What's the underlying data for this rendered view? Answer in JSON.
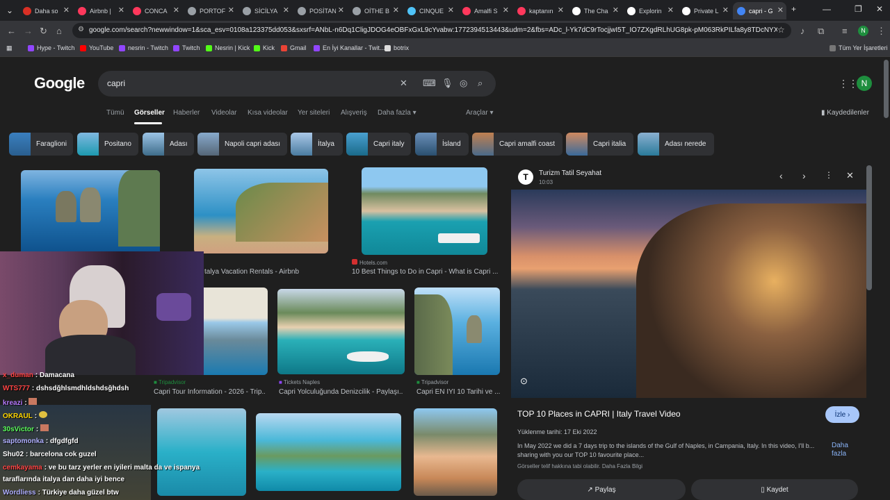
{
  "tabs": [
    {
      "label": "Daha so",
      "color": "#d93025"
    },
    {
      "label": "Airbnb |",
      "color": "#ff385c"
    },
    {
      "label": "CONCA",
      "color": "#ff385c"
    },
    {
      "label": "PORTOF",
      "color": "#9aa0a6"
    },
    {
      "label": "SİCİLYA",
      "color": "#9aa0a6"
    },
    {
      "label": "POSİTAN",
      "color": "#9aa0a6"
    },
    {
      "label": "OİTHE B",
      "color": "#9aa0a6"
    },
    {
      "label": "CINQUE",
      "color": "#4fc3f7"
    },
    {
      "label": "Amalfi S",
      "color": "#ff385c"
    },
    {
      "label": "kaptanın",
      "color": "#ff385c"
    },
    {
      "label": "The Cha",
      "color": "#ffffff"
    },
    {
      "label": "Explorin",
      "color": "#ffffff"
    },
    {
      "label": "Private L",
      "color": "#ffffff"
    },
    {
      "label": "capri - G",
      "color": "#4285f4"
    }
  ],
  "url": "google.com/search?newwindow=1&sca_esv=0108a123375dd053&sxsrf=ANbL-n6Dq1CligJDOG4eOBFxGxL9cYvabw:1772394513443&udm=2&fbs=ADc_l-Yk7dC9rTocjjwI5T_IO7ZXgdRLhUG8pk-pM063RkPILfa8y8TDcNYX0oihjHX-_gadUwZ...",
  "bookmarks": [
    {
      "label": "Hype - Twitch",
      "color": "#9146ff"
    },
    {
      "label": "YouTube",
      "color": "#ff0000"
    },
    {
      "label": "nesrin - Twitch",
      "color": "#9146ff"
    },
    {
      "label": "Twitch",
      "color": "#9146ff"
    },
    {
      "label": "Nesrin | Kick",
      "color": "#53fc18"
    },
    {
      "label": "Kick",
      "color": "#53fc18"
    },
    {
      "label": "Gmail",
      "color": "#ea4335"
    },
    {
      "label": "En İyi Kanallar - Twit...",
      "color": "#9146ff"
    },
    {
      "label": "botrix",
      "color": "#dddddd"
    }
  ],
  "all_bookmarks": "Tüm Yer İşaretleri",
  "google": {
    "logo": "Google",
    "query": "capri",
    "avatar_letter": "N",
    "nav_tabs": [
      "Tümü",
      "Görseller",
      "Haberler",
      "Videolar",
      "Kısa videolar",
      "Yer siteleri",
      "Alışveriş",
      "Daha fazla",
      "Araçlar"
    ],
    "saved": "Kaydedilenler",
    "chips": [
      "Faraglioni",
      "Positano",
      "Adası",
      "Napoli capri adası",
      "İtalya",
      "Capri italy",
      "İsland",
      "Capri amalfi coast",
      "Capri italia",
      "Adası nerede"
    ]
  },
  "results": [
    {
      "source": "hb",
      "title": "talya Vacation Rentals - Airbnb"
    },
    {
      "source": "Hotels.com",
      "title": "10 Best Things to Do in Capri - What is Capri ..."
    },
    {
      "source": "Tripadvisor",
      "title": "Capri Tour Information - 2026 - Trip..."
    },
    {
      "source": "Tickets Naples",
      "title": "Capri Yolculuğunda Denizcilik - Paylaşı..."
    },
    {
      "source": "Tripadvisor",
      "title": "Capri EN İYİ 10 Tarihi ve ..."
    }
  ],
  "panel": {
    "source": "Turizm Tatil Seyahat",
    "time": "10:03",
    "title": "TOP 10 Places in CAPRI | Italy Travel Video",
    "watch": "İzle",
    "date": "Yüklenme tarihi: 17 Eki 2022",
    "description": "In May 2022 we did a 7 days trip to the islands of the Gulf of Naples, in Campania, Italy. In this video, I'll b... sharing with you our TOP 10 favourite place...",
    "more": "Daha fazla",
    "license": "Görseller telif hakkına tabi olabilir. Daha Fazla Bilgi",
    "share": "Paylaş",
    "save": "Kaydet"
  },
  "chat": [
    {
      "user": "x_duman",
      "msg": "Damacana",
      "color": "#ff4444"
    },
    {
      "user": "WTS777",
      "msg": "dshsdğhlsmdhldshdsğhdsh",
      "color": "#ff4444"
    },
    {
      "user": "kreazi",
      "msg": "",
      "color": "#b57bff"
    },
    {
      "user": "OKRAUL",
      "msg": "",
      "color": "#ffd700"
    },
    {
      "user": "30sVictor",
      "msg": "",
      "color": "#5cff5c"
    },
    {
      "user": "saptomonka",
      "msg": "dfgdfgfd",
      "color": "#b0b0ff"
    },
    {
      "user": "Shu02",
      "msg": "barcelona cok guzel",
      "color": "#ffffff"
    },
    {
      "user": "cemkayama",
      "msg": "ve bu tarz yerler en iyileri malta da ve ispanya",
      "color": "#ff4444"
    },
    {
      "user": "",
      "msg": "taraflarında italya dan daha iyi bence",
      "color": "#ffffff"
    },
    {
      "user": "Wordliess",
      "msg": "Türkiye daha güzel btw",
      "color": "#b0b0ff"
    }
  ],
  "colors": {
    "accent": "#8ab4f8",
    "avatar": "#1e8e3e"
  }
}
